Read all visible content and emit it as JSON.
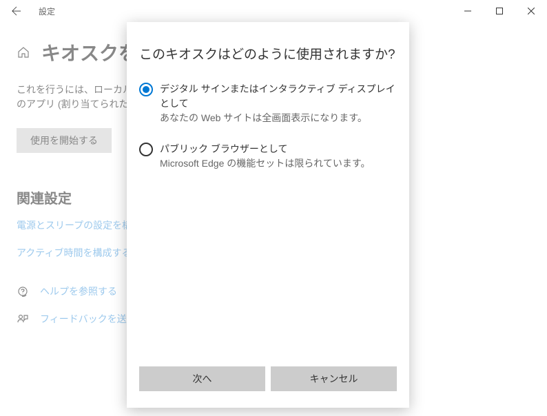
{
  "titlebar": {
    "title": "設定"
  },
  "page": {
    "title": "キオスクを",
    "description": "これを行うには、ローカル ア\nのアプリ (割り当てられたアク",
    "start_button": "使用を開始する"
  },
  "related": {
    "title": "関連設定",
    "links": [
      "電源とスリープの設定を構成",
      "アクティブ時間を構成する"
    ]
  },
  "help": {
    "items": [
      "ヘルプを参照する",
      "フィードバックを送信"
    ]
  },
  "dialog": {
    "title": "このキオスクはどのように使用されますか?",
    "options": [
      {
        "label": "デジタル サインまたはインタラクティブ ディスプレイとして",
        "sublabel": "あなたの Web サイトは全画面表示になります。",
        "selected": true
      },
      {
        "label": "パブリック ブラウザーとして",
        "sublabel": "Microsoft Edge の機能セットは限られています。",
        "selected": false
      }
    ],
    "next_button": "次へ",
    "cancel_button": "キャンセル"
  }
}
